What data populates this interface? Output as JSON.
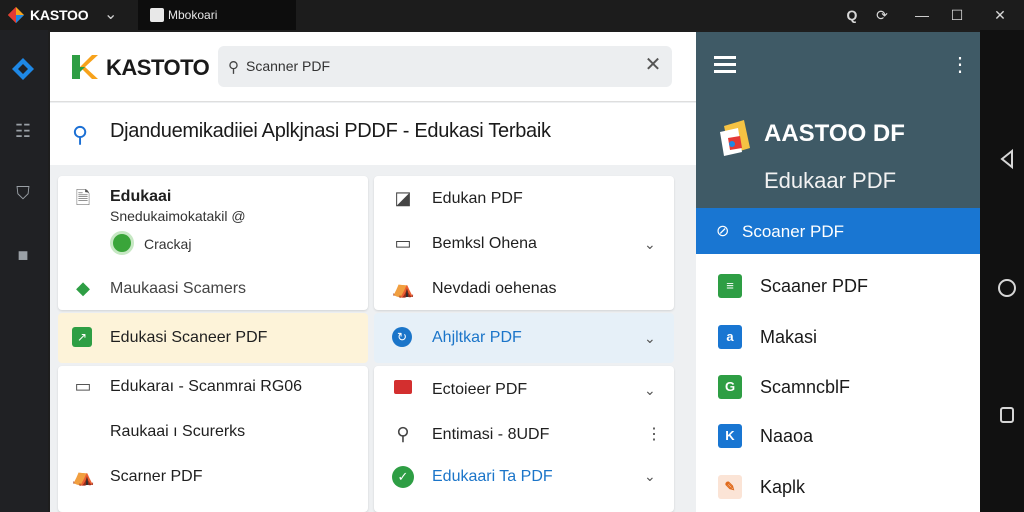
{
  "window": {
    "app_title": "KASTOO",
    "tab_label": "Mbokoari"
  },
  "header": {
    "brand": "KASTOTO",
    "search_value": "Scanner PDF"
  },
  "subheader": {
    "title": "Djanduemikadiiei Aplkjnasi PDDF - Edukasi Terbaik"
  },
  "left_panel": {
    "card1": {
      "title": "Edukaai",
      "subtitle": "Snedukaimokatakil @",
      "badge": "Crackaj"
    },
    "item_scanner": "Maukaasi Scamers",
    "item_highlight": "Edukasi Scaneer PDF",
    "card3": {
      "line1": "Edukaraı - Scanmrai RG06",
      "line2": "Raukaai ı Scurerks",
      "line3": "Scarner PDF"
    }
  },
  "right_panel": {
    "items": [
      {
        "label": "Edukan PDF",
        "chevron": false,
        "icon": "document-icon"
      },
      {
        "label": "Bemksl Ohena",
        "chevron": true,
        "icon": "window-icon"
      },
      {
        "label": "Nevdadi oehenas",
        "chevron": false,
        "icon": "user-icon"
      },
      {
        "label": "Ahjltkar PDF",
        "chevron": true,
        "icon": "refresh-icon",
        "color": "#1b75c9"
      },
      {
        "label": "Ectoieer PDF",
        "chevron": true,
        "icon": "pdf-icon"
      },
      {
        "label": "Entimasi - 8UDF",
        "chevron": false,
        "icon": "search-icon",
        "kebab": true
      },
      {
        "label": "Edukaari Ta PDF",
        "chevron": true,
        "icon": "check-icon",
        "color": "#1b75c9"
      }
    ]
  },
  "drawer": {
    "title": "AASTOO DF",
    "subtitle": "Edukaar PDF",
    "active_item": "Scoaner PDF",
    "items": [
      {
        "label": "Scaaner PDF",
        "icon": "sheet-icon",
        "color": "#2e9e44",
        "glyph": "≡"
      },
      {
        "label": "Makasi",
        "icon": "doc-icon",
        "color": "#1976d2",
        "glyph": "a"
      },
      {
        "label": "ScamncblF",
        "icon": "scan-icon",
        "color": "#2e9e44",
        "glyph": "G"
      },
      {
        "label": "Naaoa",
        "icon": "arrow-icon",
        "color": "#1976d2",
        "glyph": "K"
      },
      {
        "label": "Kaplk",
        "icon": "pen-icon",
        "color": "#e06a1b",
        "glyph": "✎"
      }
    ]
  },
  "colors": {
    "accent": "#1976d2",
    "drawer_header": "#3f5a66",
    "highlight_yellow": "#fdf3d9",
    "highlight_blue": "#e6f0f8"
  }
}
